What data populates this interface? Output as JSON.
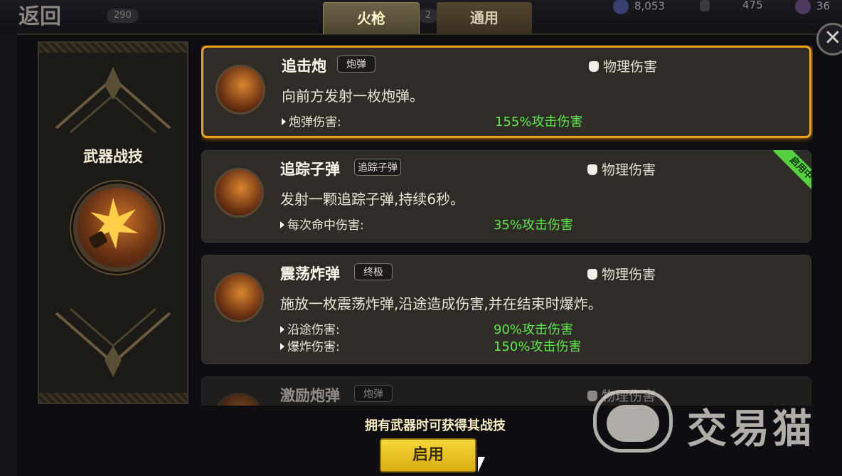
{
  "header": {
    "back_label": "返回",
    "badges": [
      "290",
      "2"
    ],
    "resources": [
      {
        "icon": "crystal-icon",
        "value": "8,053"
      },
      {
        "icon": "lock-icon",
        "value": "475"
      },
      {
        "icon": "gem-icon",
        "value": "36"
      }
    ]
  },
  "tabs": [
    {
      "label": "火枪",
      "active": true
    },
    {
      "label": "通用",
      "active": false
    }
  ],
  "left_panel": {
    "title": "武器战技",
    "icon": "cannon-blast-icon"
  },
  "skills": [
    {
      "name": "追击炮",
      "tag": "炮弹",
      "type": "物理伤害",
      "description": "向前方发射一枚炮弹。",
      "stats": [
        {
          "label": "炮弹伤害:",
          "value": "155%攻击伤害"
        }
      ],
      "selected": true,
      "equipped_ribbon": "",
      "icon": "cannon-shot-icon"
    },
    {
      "name": "追踪子弹",
      "tag": "追踪子弹",
      "type": "物理伤害",
      "description": "发射一颗追踪子弹,持续6秒。",
      "stats": [
        {
          "label": "每次命中伤害:",
          "value": "35%攻击伤害"
        }
      ],
      "selected": false,
      "equipped_ribbon": "启用中",
      "icon": "homing-bullet-icon"
    },
    {
      "name": "震荡炸弹",
      "tag": "终极",
      "type": "物理伤害",
      "description": "施放一枚震荡炸弹,沿途造成伤害,并在结束时爆炸。",
      "stats": [
        {
          "label": "沿途伤害:",
          "value": "90%攻击伤害"
        },
        {
          "label": "爆炸伤害:",
          "value": "150%攻击伤害"
        }
      ],
      "selected": false,
      "equipped_ribbon": "",
      "icon": "shock-bomb-icon"
    },
    {
      "name": "激励炮弹",
      "tag": "炮弹",
      "type": "物理伤害",
      "selected": false,
      "icon": "inspire-shell-icon"
    }
  ],
  "footer": {
    "hint": "拥有武器时可获得其战技",
    "enable_label": "启用"
  },
  "watermark": {
    "text": "交易猫"
  }
}
